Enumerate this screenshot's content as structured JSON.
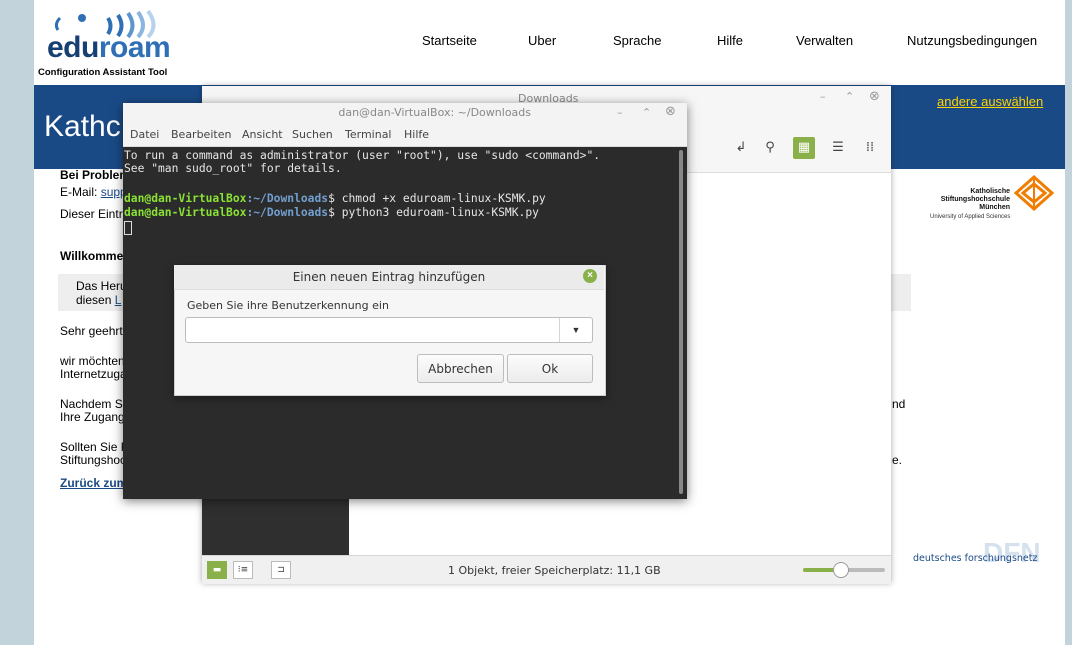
{
  "nav": {
    "items": [
      "Startseite",
      "Uber",
      "Sprache",
      "Hilfe",
      "Verwalten",
      "Nutzungsbedingungen"
    ]
  },
  "logo": {
    "edu": "edu",
    "roam": "roam",
    "subtitle": "Configuration Assistant Tool"
  },
  "banner": {
    "title": "Kathc",
    "other_link": "andere auswählen"
  },
  "page": {
    "problem_head": "Bei Problem",
    "email_label": "E-Mail:",
    "email_link": "supp",
    "dieser": "Dieser Eintr",
    "welcome": "Willkomme",
    "grey_line1": "Das Heru",
    "grey_line2a": "diesen",
    "grey_line2b": "L",
    "sehr": "Sehr geehrt",
    "wir1": "wir möchten",
    "wir2": "Internetzuga",
    "nachdem1": "Nachdem Si",
    "nachdem2": "Ihre Zugang",
    "nachdem_tail": "nd",
    "sollten1": "Sollten Sie F",
    "sollten2": "Stiftungshoc",
    "sollten_tail": "e.",
    "back_link": "Zurück zum"
  },
  "ksh": {
    "line1": "Katholische",
    "line2": "Stiftungshochschule",
    "line3": "München",
    "sub": "University of Applied Sciences",
    "accent_color": "#f07d00"
  },
  "dfn": {
    "big": "DFN",
    "text": "deutsches forschungsnetz"
  },
  "file_manager": {
    "title": "Downloads",
    "status": "1 Objekt, freier Speicherplatz: 11,1 GB",
    "zoom_level": 0.45
  },
  "terminal": {
    "title": "dan@dan-VirtualBox: ~/Downloads",
    "menu": [
      "Datei",
      "Bearbeiten",
      "Ansicht",
      "Suchen",
      "Terminal",
      "Hilfe"
    ],
    "line1": "To run a command as administrator (user \"root\"), use \"sudo <command>\".",
    "line2": "See \"man sudo_root\" for details.",
    "prompt_user": "dan@dan-VirtualBox",
    "prompt_sep": ":",
    "prompt_path": "~/Downloads",
    "prompt_end": "$ ",
    "cmd1": "chmod +x eduroam-linux-KSMK.py",
    "cmd2": "python3 eduroam-linux-KSMK.py"
  },
  "dialog": {
    "title": "Einen neuen Eintrag hinzufügen",
    "label": "Geben Sie ihre Benutzerkennung ein",
    "input_value": "",
    "cancel": "Abbrechen",
    "ok": "Ok"
  },
  "colors": {
    "banner": "#1a4a86",
    "link_yellow": "#ffd200",
    "mint_green": "#8ab04a"
  }
}
